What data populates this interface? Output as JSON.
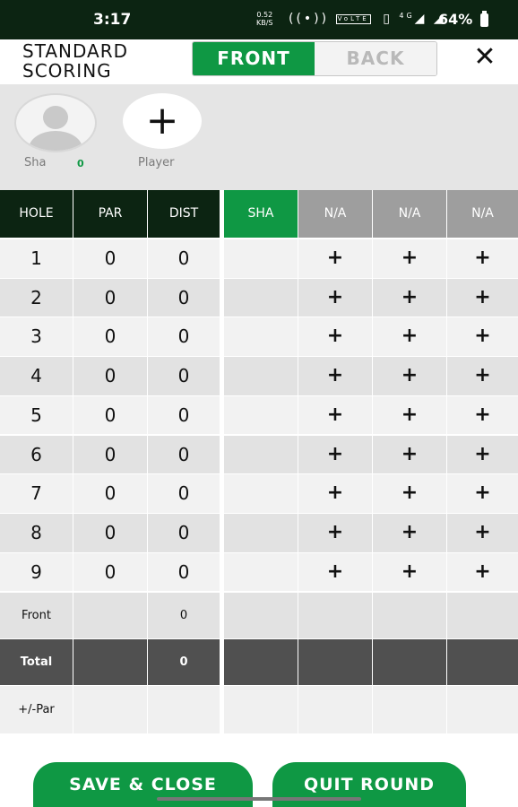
{
  "status_bar": {
    "time": "3:17",
    "net_speed_value": "0.52",
    "net_speed_unit": "KB/S",
    "battery": "64%",
    "volte_label": "VoLTE",
    "signal_label": "4G"
  },
  "header": {
    "title": "STANDARD SCORING",
    "tab_front": "FRONT",
    "tab_back": "BACK",
    "close_icon": "close-icon",
    "active_tab": "FRONT"
  },
  "players": {
    "player1": {
      "name": "Sha",
      "score": "0",
      "icon": "avatar-placeholder-icon"
    },
    "add_player": {
      "label": "Player",
      "icon": "plus-icon"
    }
  },
  "table": {
    "columns": [
      "HOLE",
      "PAR",
      "DIST",
      "SHA",
      "N/A",
      "N/A",
      "N/A"
    ],
    "rows": [
      {
        "hole": "1",
        "par": "0",
        "dist": "0"
      },
      {
        "hole": "2",
        "par": "0",
        "dist": "0"
      },
      {
        "hole": "3",
        "par": "0",
        "dist": "0"
      },
      {
        "hole": "4",
        "par": "0",
        "dist": "0"
      },
      {
        "hole": "5",
        "par": "0",
        "dist": "0"
      },
      {
        "hole": "6",
        "par": "0",
        "dist": "0"
      },
      {
        "hole": "7",
        "par": "0",
        "dist": "0"
      },
      {
        "hole": "8",
        "par": "0",
        "dist": "0"
      },
      {
        "hole": "9",
        "par": "0",
        "dist": "0"
      }
    ],
    "add_score_symbol": "+",
    "summary": [
      {
        "label": "Front",
        "dist": "0"
      },
      {
        "label": "Total",
        "dist": "0"
      },
      {
        "label": "+/-Par",
        "dist": ""
      }
    ]
  },
  "footer": {
    "save_close": "SAVE & CLOSE",
    "quit_round": "QUIT ROUND"
  },
  "colors": {
    "brand_green": "#0f9844",
    "dark_green": "#0c2412",
    "na_header": "#9e9e9e",
    "total_row": "#505050"
  }
}
